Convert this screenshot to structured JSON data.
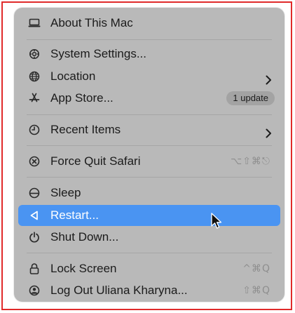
{
  "menu": {
    "about": {
      "label": "About This Mac",
      "icon": "laptop-icon"
    },
    "system_settings": {
      "label": "System Settings...",
      "icon": "gear-icon"
    },
    "location": {
      "label": "Location",
      "icon": "globe-icon",
      "has_submenu": true
    },
    "app_store": {
      "label": "App Store...",
      "icon": "app-store-icon",
      "badge": "1 update"
    },
    "recent_items": {
      "label": "Recent Items",
      "icon": "clock-icon",
      "has_submenu": true
    },
    "force_quit": {
      "label": "Force Quit Safari",
      "icon": "force-quit-icon",
      "shortcut": "⌥⇧⌘⎋"
    },
    "sleep": {
      "label": "Sleep",
      "icon": "sleep-icon"
    },
    "restart": {
      "label": "Restart...",
      "icon": "restart-icon",
      "highlighted": true
    },
    "shut_down": {
      "label": "Shut Down...",
      "icon": "power-icon"
    },
    "lock_screen": {
      "label": "Lock Screen",
      "icon": "lock-icon",
      "shortcut": "^⌘Q"
    },
    "log_out": {
      "label": "Log Out Uliana Kharyna...",
      "icon": "user-icon",
      "shortcut": "⇧⌘Q"
    }
  },
  "colors": {
    "menu_background": "#b9b9b9",
    "highlight": "#4a94f2",
    "text": "#1b1b1b",
    "shortcut_text": "#8e8e8e",
    "frame_border": "#e02a2a"
  }
}
